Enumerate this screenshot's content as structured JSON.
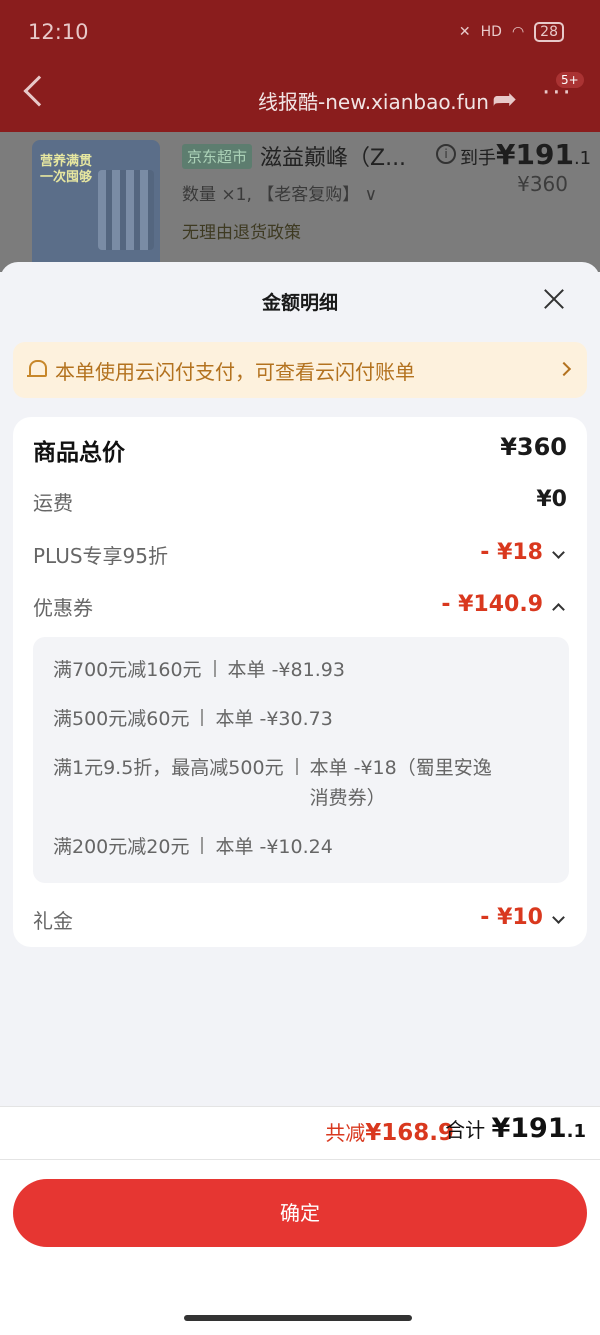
{
  "status_bar": {
    "time": "12:10",
    "network": "HD",
    "battery": "28"
  },
  "header": {
    "watermark": "线报酷-new.xianbao.fun",
    "more_badge": "5+"
  },
  "product": {
    "thumb_text": "营养满贯 一次囤够",
    "store_tag": "京东超市",
    "title": "滋益巅峰（Z...",
    "final_price_label": "到手",
    "final_price_main": "¥191",
    "final_price_dec": ".1",
    "original_price": "¥360",
    "quantity": "数量 ×1, 【老客复购】 ∨",
    "return_policy": "无理由退货政策"
  },
  "sheet": {
    "title": "金额明细",
    "notice": "本单使用云闪付支付，可查看云闪付账单",
    "rows": {
      "total": {
        "label": "商品总价",
        "value": "¥360"
      },
      "shipping": {
        "label": "运费",
        "value": "¥0"
      },
      "plus": {
        "label": "PLUS专享95折",
        "value": "- ¥18"
      },
      "coupon": {
        "label": "优惠券",
        "value": "- ¥140.9"
      },
      "gift": {
        "label": "礼金",
        "value": "- ¥10"
      }
    },
    "coupons": [
      {
        "rule": "满700元减160元",
        "deduction": "本单 -¥81.93"
      },
      {
        "rule": "满500元减60元",
        "deduction": "本单 -¥30.73"
      },
      {
        "rule": "满1元9.5折，最高减500元",
        "deduction": "本单 -¥18（蜀里安逸消费券）"
      },
      {
        "rule": "满200元减20元",
        "deduction": "本单 -¥10.24"
      }
    ]
  },
  "footer": {
    "saved_label": "共减",
    "saved_value": "¥168.9",
    "sum_label": "合计",
    "sum_main": "¥191",
    "sum_dec": ".1",
    "confirm": "确定"
  },
  "colors": {
    "accent": "#e63632",
    "discount": "#d9381e",
    "notice_bg": "#fdf1dd"
  }
}
